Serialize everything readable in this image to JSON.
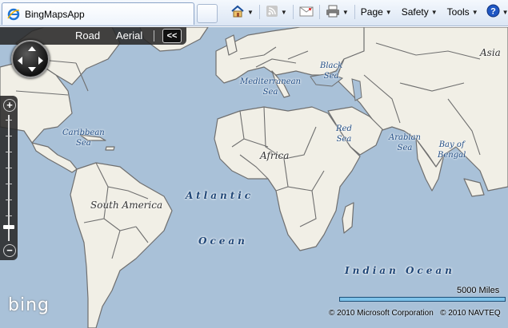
{
  "browser": {
    "tab_title": "BingMapsApp",
    "commands": [
      {
        "label": "Page",
        "icon": "page-icon"
      },
      {
        "label": "Safety",
        "icon": "safety-icon"
      },
      {
        "label": "Tools",
        "icon": "tools-icon"
      }
    ],
    "icons": [
      "ie-logo-icon",
      "home-icon",
      "rss-feeds-icon",
      "read-mail-icon",
      "print-icon",
      "help-icon"
    ]
  },
  "map": {
    "modes": {
      "road": "Road",
      "aerial": "Aerial"
    },
    "collapse_label": "<<",
    "labels": {
      "asia": "Asia",
      "black_sea": "Black\nSea",
      "mediterranean_sea": "Mediterranean\nSea",
      "caribbean_sea": "Caribbean\nSea",
      "red_sea": "Red\nSea",
      "arabian_sea": "Arabian\nSea",
      "bay_of_bengal": "Bay of\nBengal",
      "africa": "Africa",
      "south_america": "South America",
      "atlantic": "Atlantic",
      "ocean": "Ocean",
      "indian_ocean": "Indian Ocean"
    },
    "zoom": {
      "in": "+",
      "out": "−"
    },
    "logo": "bing",
    "scale": "5000 Miles",
    "copyright": "© 2010 Microsoft Corporation   © 2010 NAVTEQ",
    "colors": {
      "water": "#a9c1d8",
      "land": "#f1efe6",
      "border": "#6f6f6f"
    }
  }
}
